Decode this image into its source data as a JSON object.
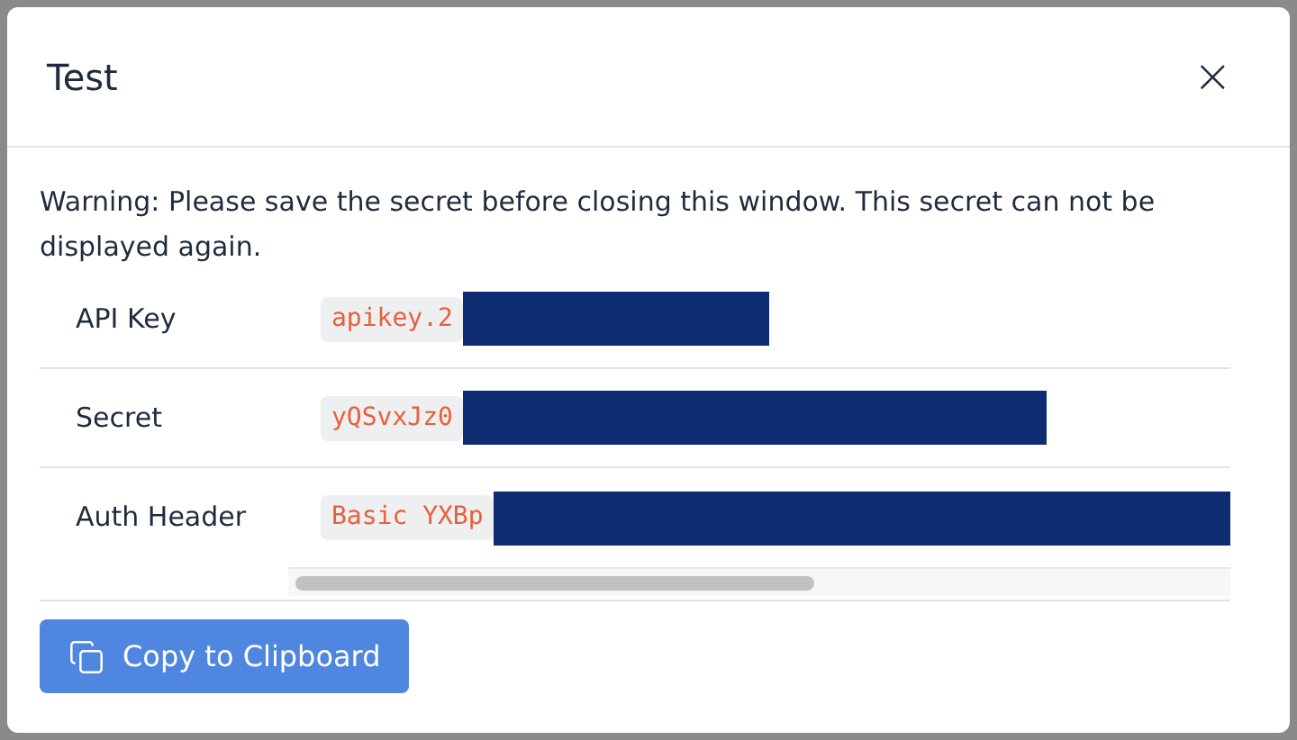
{
  "dialog": {
    "title": "Test",
    "close": "×"
  },
  "warning": "Warning: Please save the secret before closing this window. This secret can not be displayed again.",
  "rows": [
    {
      "label": "API Key",
      "value": "apikey.2"
    },
    {
      "label": "Secret",
      "value": "yQSvxJz0"
    },
    {
      "label": "Auth Header",
      "value": "Basic YXBp"
    }
  ],
  "button": {
    "label": "Copy to Clipboard"
  }
}
